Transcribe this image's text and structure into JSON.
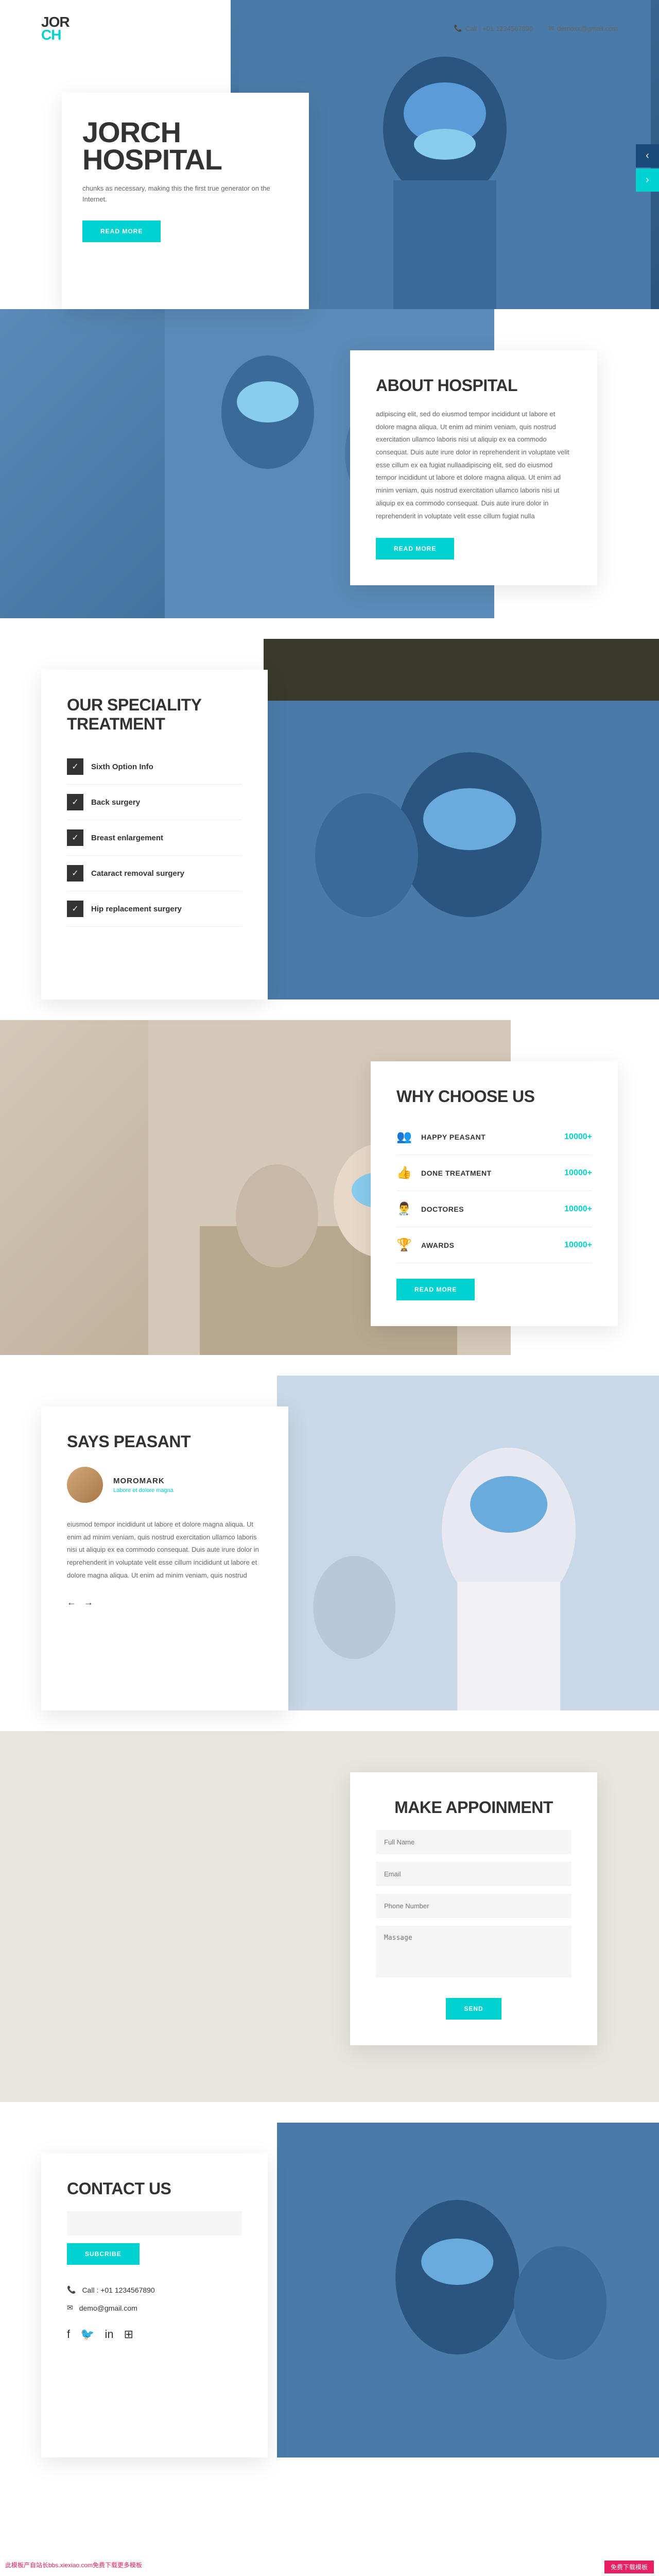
{
  "header": {
    "logo1": "JOR",
    "logo2": "CH",
    "phone": "Call : +01 1234567890",
    "email": "demoxx@gmail.com"
  },
  "hero": {
    "title": "JORCH HOSPITAL",
    "subtitle": "chunks as necessary, making this the first true generator on the Internet.",
    "btn": "READ MORE"
  },
  "about": {
    "title": "ABOUT HOSPITAL",
    "text": "adipiscing elit, sed do eiusmod tempor incididunt ut labore et dolore magna aliqua. Ut enim ad minim veniam, quis nostrud exercitation ullamco laboris nisi ut aliquip ex ea commodo consequat. Duis aute irure dolor in reprehenderit in voluptate velit esse cillum ex ea fugiat nullaadipiscing elit, sed do eiusmod tempor incididunt ut labore et dolore magna aliqua. Ut enim ad minim veniam, quis nostrud exercitation ullamco laboris nisi ut aliquip ex ea commodo consequat. Duis aute irure dolor in reprehenderit in voluptate velit esse cillum fugiat nulla",
    "btn": "READ MORE"
  },
  "specialty": {
    "title": "OUR SPECIALITY TREATMENT",
    "items": [
      "Sixth Option Info",
      "Back surgery",
      "Breast enlargement",
      "Cataract removal surgery",
      "Hip replacement surgery"
    ]
  },
  "why": {
    "title": "WHY CHOOSE US",
    "stats": [
      {
        "label": "HAPPY PEASANT",
        "value": "10000+"
      },
      {
        "label": "DONE TREATMENT",
        "value": "10000+"
      },
      {
        "label": "DOCTORES",
        "value": "10000+"
      },
      {
        "label": "AWARDS",
        "value": "10000+"
      }
    ],
    "btn": "READ MORE"
  },
  "testimonial": {
    "title": "SAYS PEASANT",
    "name": "MOROMARK",
    "sub": "Labore et dolore magna",
    "text": "eiusmod tempor incididunt ut labore et dolore magna aliqua. Ut enim ad minim veniam, quis nostrud exercitation ullamco laboris nisi ut aliquip ex ea commodo consequat. Duis aute irure dolor in reprehenderit in voluptate velit esse cillum incididunt ut labore et dolore magna aliqua. Ut enim ad minim veniam, quis nostrud"
  },
  "appointment": {
    "title": "MAKE APPOINMENT",
    "ph_name": "Full Name",
    "ph_email": "Email",
    "ph_phone": "Phone Number",
    "ph_msg": "Massage",
    "btn": "SEND"
  },
  "contact": {
    "title": "CONTACT US",
    "btn": "SUBCRIBE",
    "phone": "Call : +01 1234567890",
    "email": "demo@gmail.com"
  },
  "watermark": {
    "left": "此模板产自站长bbs.xiexiao.com免费下载更多模板",
    "right": "免费下载模板"
  }
}
